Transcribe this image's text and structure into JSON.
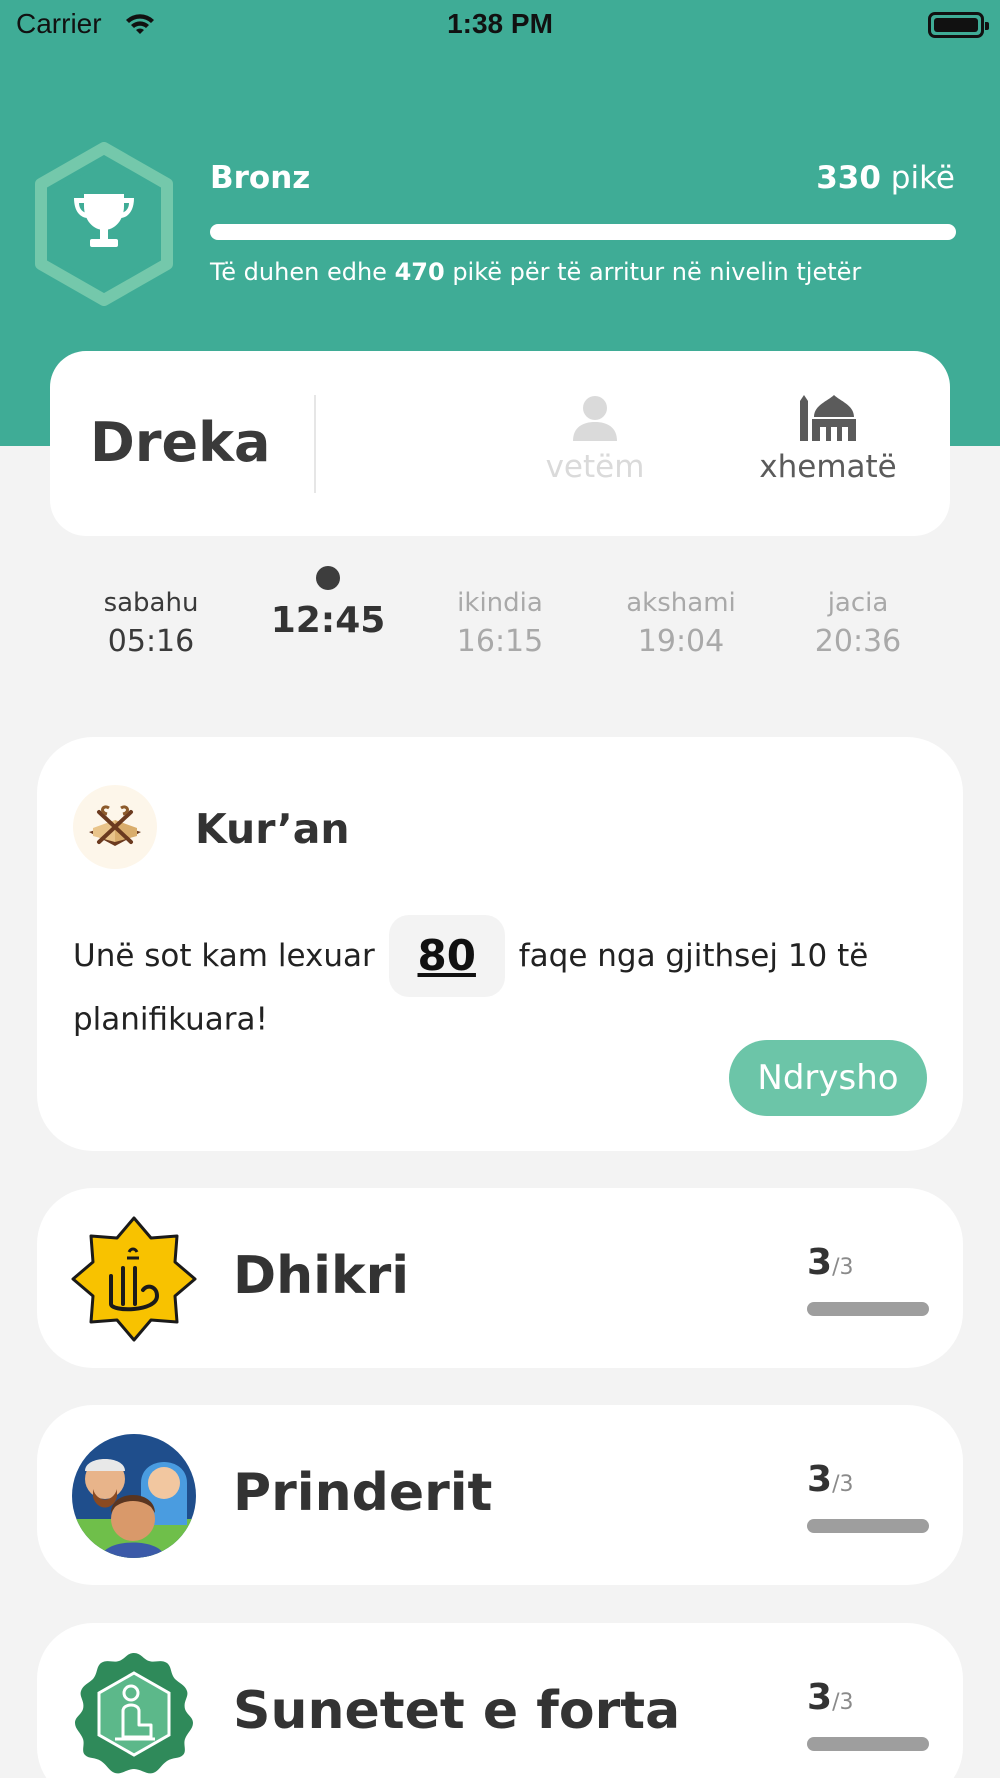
{
  "status_bar": {
    "carrier": "Carrier",
    "time": "1:38 PM"
  },
  "level": {
    "name": "Bronz",
    "points_value": "330",
    "points_unit": "pikë",
    "progress_fraction": 1.0,
    "hint_prefix": "Të duhen edhe",
    "hint_points": "470",
    "hint_suffix": "pikë për të arritur në nivelin tjetër",
    "badge_icon": "trophy-icon",
    "badge_color": "#74c8ab"
  },
  "prayer": {
    "name": "Dreka",
    "options": [
      {
        "label": "vetëm",
        "icon": "person-icon",
        "selected": false
      },
      {
        "label": "xhematë",
        "icon": "mosque-icon",
        "selected": true
      }
    ]
  },
  "prayer_times": [
    {
      "name": "sabahu",
      "time": "05:16",
      "state": "past"
    },
    {
      "name": "",
      "time": "12:45",
      "state": "current"
    },
    {
      "name": "ikindia",
      "time": "16:15",
      "state": "future"
    },
    {
      "name": "akshami",
      "time": "19:04",
      "state": "future"
    },
    {
      "name": "jacia",
      "time": "20:36",
      "state": "future"
    }
  ],
  "quran": {
    "title": "Kur’an",
    "icon": "quran-book-icon",
    "text_before": "Unë sot kam lexuar",
    "pages_read": "80",
    "text_after": "faqe nga gjithsej 10 të planifikuara!",
    "button_label": "Ndrysho"
  },
  "tasks": [
    {
      "title": "Dhikri",
      "icon": "allah-star-icon",
      "done": "3",
      "total": "/3"
    },
    {
      "title": "Prinderit",
      "icon": "family-icon",
      "done": "3",
      "total": "/3"
    },
    {
      "title": "Sunetet e forta",
      "icon": "praying-person-icon",
      "done": "3",
      "total": "/3"
    }
  ],
  "colors": {
    "header_bg": "#3fac96",
    "accent_button": "#6cc5a8",
    "page_bg": "#f3f3f3",
    "dhikr_star": "#f8c200",
    "sunnah_badge": "#2f8a5a"
  }
}
